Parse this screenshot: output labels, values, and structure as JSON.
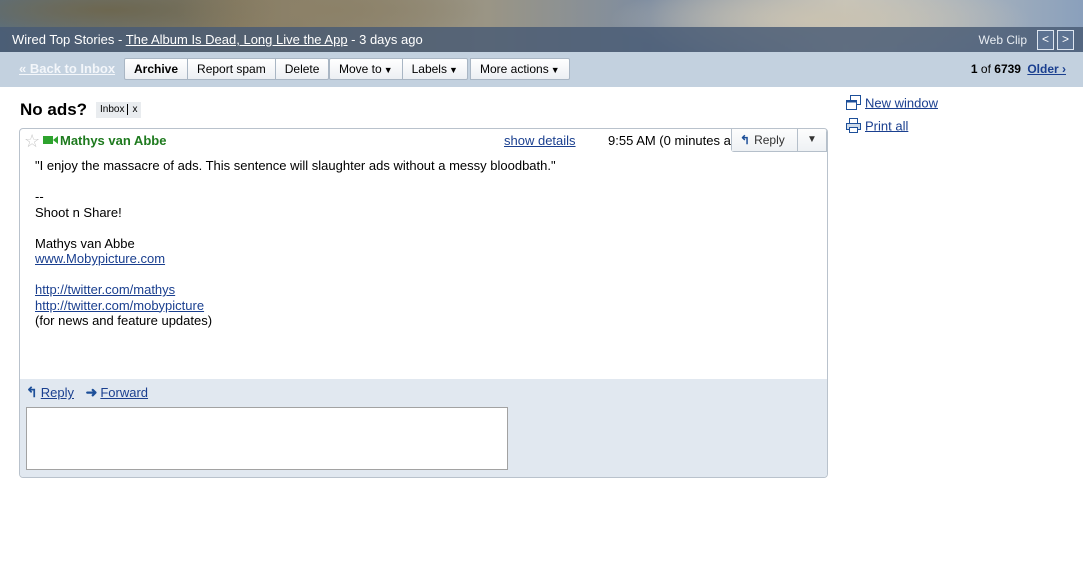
{
  "webclip": {
    "source": "Wired Top Stories",
    "dash1": " - ",
    "headline": "The Album Is Dead, Long Live the App",
    "age": " - 3 days ago",
    "label": "Web Clip",
    "prev": "<",
    "next": ">"
  },
  "toolbar": {
    "back_link": "« Back to Inbox",
    "archive": "Archive",
    "report_spam": "Report spam",
    "delete": "Delete",
    "move_to": "Move to",
    "labels": "Labels",
    "more_actions": "More actions",
    "dropdown_glyph": "▼",
    "pager_pos": "1",
    "pager_of": " of ",
    "pager_total": "6739",
    "older": "Older ›"
  },
  "subject": {
    "title": "No ads?",
    "label": "Inbox",
    "remove": "x"
  },
  "side": {
    "new_window": "New window",
    "print_all": "Print all"
  },
  "message": {
    "sender": "Mathys van Abbe",
    "show_details": "show details",
    "time": "9:55 AM (0 minutes ago)",
    "reply": "Reply",
    "more_glyph": "▼",
    "body_quote": "\"I enjoy the massacre of ads. This sentence will slaughter ads without a messy bloodbath.\"",
    "sig_dashes": "--",
    "sig_tagline": "Shoot n Share!",
    "sig_name": "Mathys van Abbe",
    "sig_site": "www.Mobypicture.com",
    "sig_twitter1": "http://twitter.com/mathys",
    "sig_twitter2": "http://twitter.com/mobypicture",
    "sig_note": "(for news and feature updates)"
  },
  "reply_area": {
    "reply": "Reply",
    "forward": "Forward"
  },
  "colors": {
    "sender": "#1e7a1e",
    "link": "#1a3f8f",
    "toolbar": "#c3d1df",
    "reply_area": "#e1e8f0"
  },
  "icons": {
    "star": "star-icon",
    "video": "video-chat-icon",
    "reply": "reply-arrow-icon",
    "forward": "forward-arrow-icon",
    "new_window": "new-window-icon",
    "print": "printer-icon"
  }
}
